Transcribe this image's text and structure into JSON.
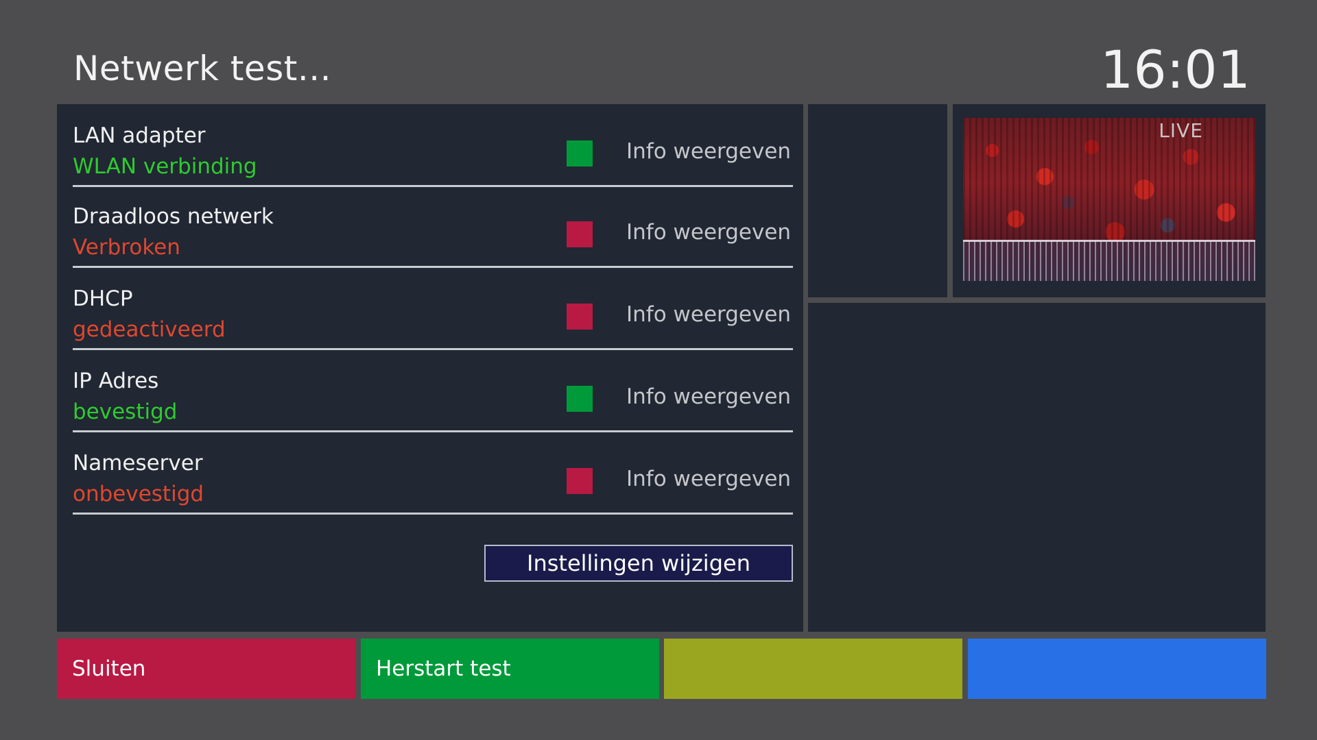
{
  "header": {
    "title": "Netwerk test...",
    "clock": "16:01"
  },
  "tests": [
    {
      "name": "LAN adapter",
      "status": "WLAN verbinding",
      "state": "ok",
      "indicator_color": "#009a3a",
      "status_color": "#2ecc30",
      "info_label": "Info weergeven"
    },
    {
      "name": "Draadloos netwerk",
      "status": "Verbroken",
      "state": "fail",
      "indicator_color": "#b81a44",
      "status_color": "#e0472f",
      "info_label": "Info weergeven"
    },
    {
      "name": "DHCP",
      "status": "gedeactiveerd",
      "state": "fail",
      "indicator_color": "#b81a44",
      "status_color": "#e0472f",
      "info_label": "Info weergeven"
    },
    {
      "name": "IP Adres",
      "status": "bevestigd",
      "state": "ok",
      "indicator_color": "#009a3a",
      "status_color": "#2ecc30",
      "info_label": "Info weergeven"
    },
    {
      "name": "Nameserver",
      "status": "onbevestigd",
      "state": "fail",
      "indicator_color": "#b81a44",
      "status_color": "#e0472f",
      "info_label": "Info weergeven"
    }
  ],
  "settings_button": {
    "label": "Instellingen wijzigen"
  },
  "preview": {
    "live_label": "LIVE"
  },
  "bottom_bar": {
    "red": {
      "label": "Sluiten",
      "color": "#b81a44"
    },
    "green": {
      "label": "Herstart test",
      "color": "#009a3a"
    },
    "yellow": {
      "label": "",
      "color": "#9aa61f"
    },
    "blue": {
      "label": "",
      "color": "#2870e6"
    }
  }
}
